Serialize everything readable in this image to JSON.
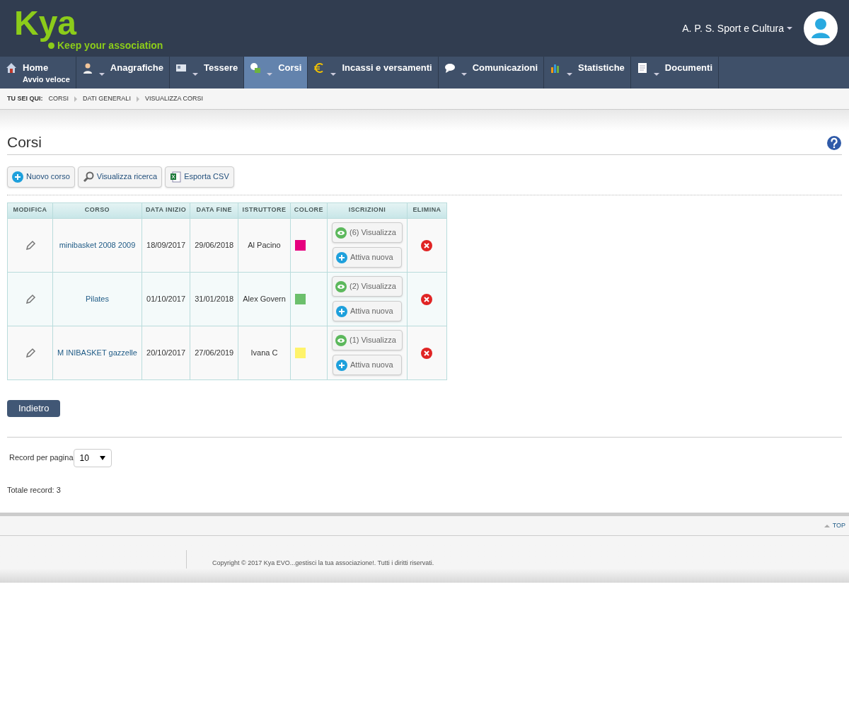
{
  "header": {
    "logo": "Kya",
    "tagline": "Keep your association",
    "account": "A. P. S. Sport e Cultura"
  },
  "nav": [
    {
      "kind": "home",
      "label": "Home",
      "sublabel": "Avvio veloce",
      "dropdown": false,
      "selected": false
    },
    {
      "kind": "person",
      "label": "Anagrafiche",
      "dropdown": true,
      "selected": false
    },
    {
      "kind": "card",
      "label": "Tessere",
      "dropdown": true,
      "selected": false
    },
    {
      "kind": "courses",
      "label": "Corsi",
      "dropdown": true,
      "selected": true
    },
    {
      "kind": "euro",
      "label": "Incassi e versamenti",
      "dropdown": true,
      "selected": false
    },
    {
      "kind": "chat",
      "label": "Comunicazioni",
      "dropdown": true,
      "selected": false
    },
    {
      "kind": "chart",
      "label": "Statistiche",
      "dropdown": true,
      "selected": false
    },
    {
      "kind": "doc",
      "label": "Documenti",
      "dropdown": true,
      "selected": false
    }
  ],
  "breadcrumb": {
    "label": "TU SEI QUI:",
    "items": [
      "CORSI",
      "DATI GENERALI",
      "VISUALIZZA CORSI"
    ]
  },
  "page_title": "Corsi",
  "toolbar": [
    {
      "kind": "plus",
      "label": "Nuovo corso"
    },
    {
      "kind": "search",
      "label": "Visualizza ricerca"
    },
    {
      "kind": "excel",
      "label": "Esporta CSV"
    }
  ],
  "table": {
    "columns": [
      "MODIFICA",
      "CORSO",
      "DATA INIZIO",
      "DATA FINE",
      "ISTRUTTORE",
      "COLORE",
      "ISCRIZIONI",
      "ELIMINA"
    ],
    "rows": [
      {
        "course": "minibasket 2008 2009",
        "start": "18/09/2017",
        "end": "29/06/2018",
        "instructor": "Al Pacino",
        "color": "#e6007e",
        "view": "(6) Visualizza",
        "add": "Attiva nuova"
      },
      {
        "course": "Pilates",
        "start": "01/10/2017",
        "end": "31/01/2018",
        "instructor": "Alex Govern",
        "color": "#6cc06c",
        "view": "(2) Visualizza",
        "add": "Attiva nuova"
      },
      {
        "course": "M INIBASKET gazzelle",
        "start": "20/10/2017",
        "end": "27/06/2019",
        "instructor": "Ivana C",
        "color": "#fff36b",
        "view": "(1) Visualizza",
        "add": "Attiva nuova"
      }
    ]
  },
  "back_button": "Indietro",
  "pagination": {
    "label": "Record per pagina",
    "value": "10",
    "total": "Totale record: 3"
  },
  "footer": {
    "top": "TOP",
    "copyright": "Copyright © 2017 Kya EVO...gestisci la tua associazione!. Tutti i diritti riservati."
  }
}
